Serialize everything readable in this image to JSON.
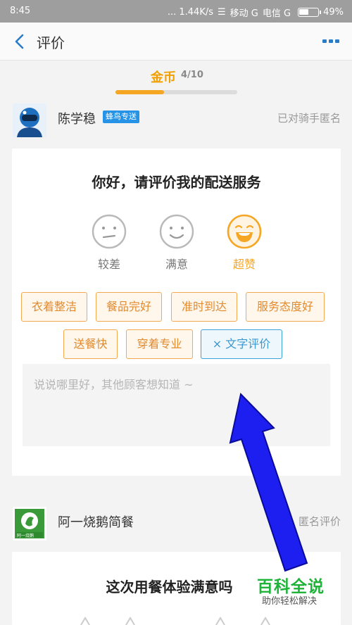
{
  "status_bar": {
    "time": "8:45",
    "network_speed": "... 1.44K/s",
    "carrier1": "移动 G",
    "carrier2": "电信 G",
    "battery": "49%"
  },
  "header": {
    "title": "评价",
    "back_icon": "chevron-left-icon",
    "more_icon": "more-dots-icon"
  },
  "coins": {
    "label": "金币",
    "count": "4/10",
    "progress": 0.4,
    "accent": "#f5a623"
  },
  "rider": {
    "name": "陈学稳",
    "badge": "蜂鸟专送",
    "anonymous_hint": "已对骑手匿名",
    "card": {
      "title": "你好，请评价我的配送服务",
      "faces": [
        {
          "label": "较差",
          "icon": "neutral-face-icon"
        },
        {
          "label": "满意",
          "icon": "smile-face-icon"
        },
        {
          "label": "超赞",
          "icon": "laugh-face-icon",
          "selected": true
        }
      ],
      "tags_row1": [
        "衣着整洁",
        "餐品完好",
        "准时到达",
        "服务态度好"
      ],
      "tags_row2": [
        "送餐快",
        "穿着专业"
      ],
      "text_eval_button": "× 文字评价",
      "comment_placeholder": "说说哪里好，其他顾客想知道 ~"
    }
  },
  "shop": {
    "name": "阿一烧鹅简餐",
    "logo_text": "阿一烧鹅",
    "anonymous_hint": "匿名评价",
    "card_title": "这次用餐体验满意吗"
  },
  "watermark": {
    "main": "百科全说",
    "sub": "助你轻松解决"
  }
}
